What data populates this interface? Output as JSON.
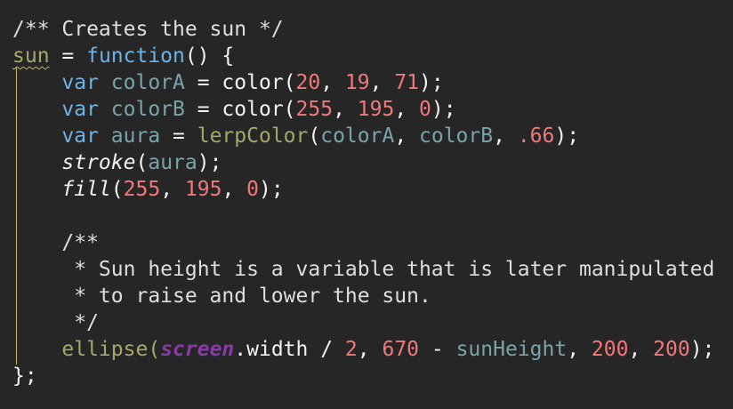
{
  "code": {
    "l1": {
      "text": "/** Creates the sun */"
    },
    "l2": {
      "name": "sun",
      "op": " = ",
      "kw": "function",
      "rest": "() {"
    },
    "l3": {
      "indent": "    ",
      "kw": "var",
      "sp": " ",
      "name": "colorA",
      "op": " = color(",
      "n1": "20",
      "c1": ", ",
      "n2": "19",
      "c2": ", ",
      "n3": "71",
      "end": ");"
    },
    "l4": {
      "indent": "    ",
      "kw": "var",
      "sp": " ",
      "name": "colorB",
      "op": " = color(",
      "n1": "255",
      "c1": ", ",
      "n2": "195",
      "c2": ", ",
      "n3": "0",
      "end": ");"
    },
    "l5": {
      "indent": "    ",
      "kw": "var",
      "sp": " ",
      "name": "aura",
      "op": " = ",
      "fn": "lerpColor",
      "open": "(",
      "a1": "colorA",
      "c1": ", ",
      "a2": "colorB",
      "c2": ", ",
      "n1": ".66",
      "end": ");"
    },
    "l6": {
      "indent": "    ",
      "fn": "stroke",
      "open": "(",
      "arg": "aura",
      "end": ");"
    },
    "l7": {
      "indent": "    ",
      "fn": "fill",
      "open": "(",
      "n1": "255",
      "c1": ", ",
      "n2": "195",
      "c2": ", ",
      "n3": "0",
      "end": ");"
    },
    "l9": {
      "text": "    /**"
    },
    "l10": {
      "text": "     * Sun height is a variable that is later manipulated"
    },
    "l11": {
      "text": "     * to raise and lower the sun."
    },
    "l12": {
      "text": "     */"
    },
    "l13": {
      "indent": "    ",
      "fn": "ellipse",
      "open": "(",
      "screen": "screen",
      "mid": ".width / ",
      "n1": "2",
      "c1": ", ",
      "n2": "670",
      "minus": " - ",
      "v1": "sunHeight",
      "c2": ", ",
      "n3": "200",
      "c3": ", ",
      "n4": "200",
      "end": ");"
    },
    "l14": {
      "text": "};"
    }
  },
  "colors": {
    "background": "#262626",
    "keyword": "#6cb3e6",
    "variable": "#7aa4a8",
    "number": "#f2777a",
    "function": "#a4a86a",
    "screen": "#8a39a8"
  }
}
